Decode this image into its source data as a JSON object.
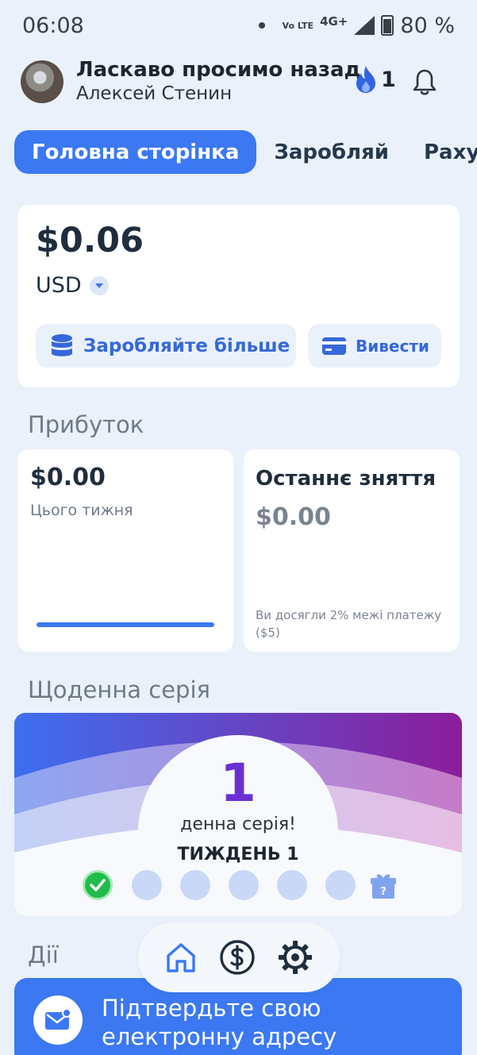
{
  "status_bar": {
    "time": "06:08",
    "volte": "Vo LTE",
    "network": "4G+",
    "battery": "80 %"
  },
  "header": {
    "title": "Ласкаво просимо назад",
    "user_name": "Алексей Стенин",
    "streak_count": "1"
  },
  "tabs": [
    {
      "label": "Головна сторінка",
      "active": true
    },
    {
      "label": "Заробляй",
      "active": false
    },
    {
      "label": "Рахунок",
      "active": false
    }
  ],
  "balance": {
    "amount": "$0.06",
    "currency": "USD",
    "earn_more_label": "Заробляйте більше",
    "withdraw_label": "Вивести"
  },
  "profit": {
    "section_title": "Прибуток",
    "this_week_amount": "$0.00",
    "this_week_label": "Цього тижня",
    "last_withdrawal_title": "Останнє зняття",
    "last_withdrawal_amount": "$0.00",
    "last_withdrawal_note": "Ви досягли 2% межі платежу ($5)"
  },
  "daily_streak": {
    "section_title": "Щоденна серія",
    "count": "1",
    "label": "денна серія!",
    "week_label": "ТИЖДЕНЬ 1",
    "days_completed": 1,
    "days_total": 6,
    "gift_symbol": "?"
  },
  "actions": {
    "section_title": "Дії",
    "verify_email_label": "Підтвердьте свою електронну адресу"
  },
  "colors": {
    "accent": "#3b78f2",
    "background": "#eaf1fb",
    "streak_number": "#6a2fd1",
    "success": "#1fbd4c"
  },
  "icons": {
    "streak": "flame-icon",
    "notifications": "bell-icon",
    "earn": "database-icon",
    "withdraw": "card-icon",
    "nav_home": "home-icon",
    "nav_earn": "dollar-circle-icon",
    "nav_settings": "gear-icon",
    "verify": "mail-icon"
  }
}
